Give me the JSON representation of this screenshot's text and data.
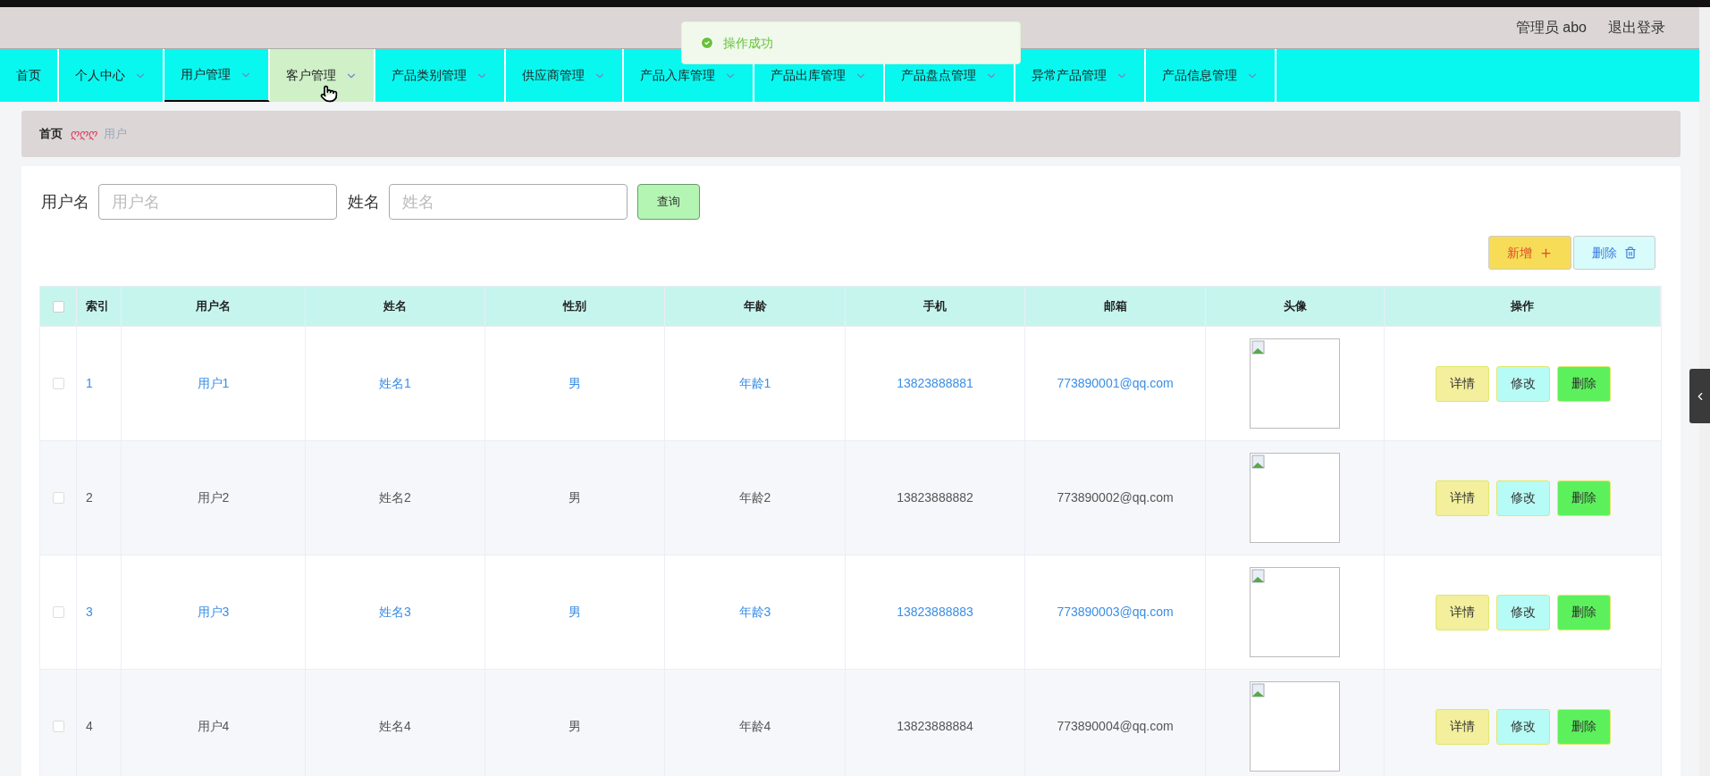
{
  "header": {
    "user": "管理员 abo",
    "logout": "退出登录"
  },
  "toast": {
    "text": "操作成功"
  },
  "nav": [
    {
      "label": "首页",
      "dropdown": false,
      "selected": false,
      "hovered": false
    },
    {
      "label": "个人中心",
      "dropdown": true,
      "selected": false,
      "hovered": false
    },
    {
      "label": "用户管理",
      "dropdown": true,
      "selected": true,
      "hovered": false
    },
    {
      "label": "客户管理",
      "dropdown": true,
      "selected": false,
      "hovered": true
    },
    {
      "label": "产品类别管理",
      "dropdown": true,
      "selected": false,
      "hovered": false
    },
    {
      "label": "供应商管理",
      "dropdown": true,
      "selected": false,
      "hovered": false
    },
    {
      "label": "产品入库管理",
      "dropdown": true,
      "selected": false,
      "hovered": false
    },
    {
      "label": "产品出库管理",
      "dropdown": true,
      "selected": false,
      "hovered": false
    },
    {
      "label": "产品盘点管理",
      "dropdown": true,
      "selected": false,
      "hovered": false
    },
    {
      "label": "异常产品管理",
      "dropdown": true,
      "selected": false,
      "hovered": false
    },
    {
      "label": "产品信息管理",
      "dropdown": true,
      "selected": false,
      "hovered": false
    }
  ],
  "breadcrumb": {
    "home": "首页",
    "separator": "ღღღ",
    "current": "用户"
  },
  "search": {
    "fields": [
      {
        "label": "用户名",
        "placeholder": "用户名"
      },
      {
        "label": "姓名",
        "placeholder": "姓名"
      }
    ],
    "button": "查询"
  },
  "actions": {
    "add": "新增",
    "delete": "删除"
  },
  "table": {
    "columns": [
      "索引",
      "用户名",
      "姓名",
      "性别",
      "年龄",
      "手机",
      "邮箱",
      "头像",
      "操作"
    ],
    "select_all": {
      "checked": false
    },
    "rows": [
      {
        "checked": false,
        "highlighted": true,
        "cells": [
          "1",
          "用户1",
          "姓名1",
          "男",
          "年龄1",
          "13823888881",
          "773890001@qq.com"
        ],
        "buttons": [
          "详情",
          "修改",
          "删除"
        ]
      },
      {
        "checked": false,
        "highlighted": false,
        "cells": [
          "2",
          "用户2",
          "姓名2",
          "男",
          "年龄2",
          "13823888882",
          "773890002@qq.com"
        ],
        "buttons": [
          "详情",
          "修改",
          "删除"
        ]
      },
      {
        "checked": false,
        "highlighted": true,
        "cells": [
          "3",
          "用户3",
          "姓名3",
          "男",
          "年龄3",
          "13823888883",
          "773890003@qq.com"
        ],
        "buttons": [
          "详情",
          "修改",
          "删除"
        ]
      },
      {
        "checked": false,
        "highlighted": false,
        "cells": [
          "4",
          "用户4",
          "姓名4",
          "男",
          "年龄4",
          "13823888884",
          "773890004@qq.com"
        ],
        "buttons": [
          "详情",
          "修改",
          "删除"
        ]
      }
    ]
  }
}
